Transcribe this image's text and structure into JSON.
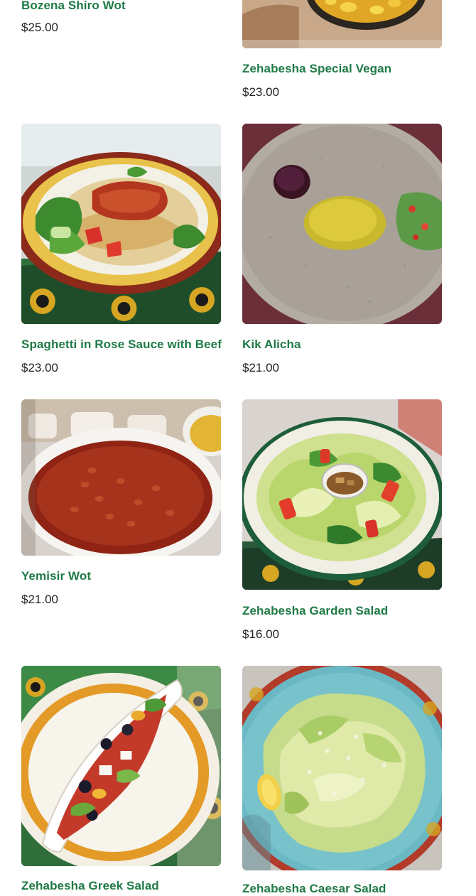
{
  "currency_symbol": "$",
  "accent_color": "#1f7a45",
  "menu_items": [
    {
      "name": "Bozena Shiro Wot",
      "price": "$25.00",
      "photo": "bozena-shiro-wot-photo"
    },
    {
      "name": "Zehabesha Special Vegan",
      "price": "$23.00",
      "photo": "zehabesha-special-vegan-photo"
    },
    {
      "name": "Spaghetti in Rose Sauce with Beef",
      "price": "$23.00",
      "photo": "spaghetti-rose-sauce-beef-photo"
    },
    {
      "name": "Kik Alicha",
      "price": "$21.00",
      "photo": "kik-alicha-photo"
    },
    {
      "name": "Yemisir Wot",
      "price": "$21.00",
      "photo": "yemisir-wot-photo"
    },
    {
      "name": "Zehabesha Garden Salad",
      "price": "$16.00",
      "photo": "zehabesha-garden-salad-photo"
    },
    {
      "name": "Zehabesha Greek Salad",
      "photo": "zehabesha-greek-salad-photo"
    },
    {
      "name": "Zehabesha Caesar Salad",
      "photo": "zehabesha-caesar-salad-photo"
    }
  ]
}
